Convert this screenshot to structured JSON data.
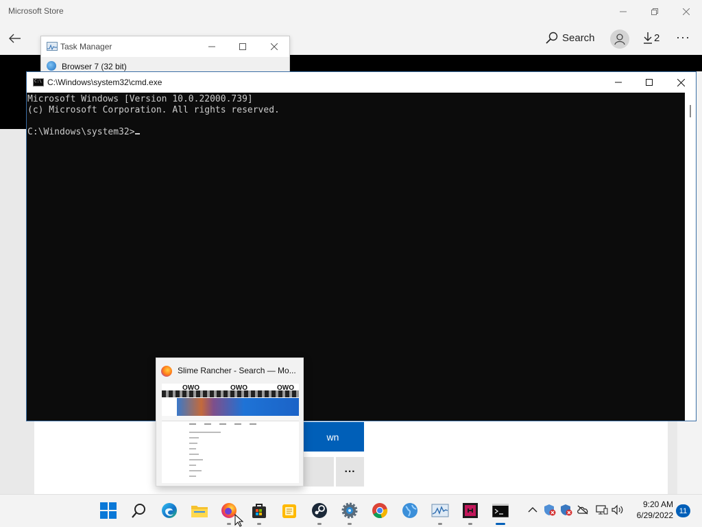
{
  "store": {
    "title": "Microsoft Store",
    "nav": {
      "search_label": "Search",
      "downloads_count": "2",
      "more_label": "···"
    },
    "install_label": "wn",
    "more_btn_label": "···"
  },
  "task_manager": {
    "title": "Task Manager",
    "process_name": "Browser 7 (32 bit)"
  },
  "cmd": {
    "title": "C:\\Windows\\system32\\cmd.exe",
    "lines": [
      "Microsoft Windows [Version 10.0.22000.739]",
      "(c) Microsoft Corporation. All rights reserved.",
      "",
      "C:\\Windows\\system32>"
    ]
  },
  "preview": {
    "title": "Slime Rancher - Search — Mo...",
    "thumb_labels": [
      "OWO",
      "OWO",
      "OWO"
    ]
  },
  "taskbar": {
    "apps": [
      {
        "name": "start",
        "icon": "windows-logo-icon"
      },
      {
        "name": "search",
        "icon": "search-icon"
      },
      {
        "name": "edge",
        "icon": "edge-icon"
      },
      {
        "name": "file-explorer",
        "icon": "folder-icon"
      },
      {
        "name": "firefox",
        "icon": "firefox-icon"
      },
      {
        "name": "microsoft-store",
        "icon": "store-icon"
      },
      {
        "name": "notes",
        "icon": "notepad-icon"
      },
      {
        "name": "steam",
        "icon": "steam-icon"
      },
      {
        "name": "settings",
        "icon": "gear-icon"
      },
      {
        "name": "chrome",
        "icon": "chrome-icon"
      },
      {
        "name": "browser",
        "icon": "globe-icon"
      },
      {
        "name": "task-manager",
        "icon": "task-manager-icon"
      },
      {
        "name": "app",
        "icon": "app-icon"
      },
      {
        "name": "command-prompt",
        "icon": "terminal-icon"
      }
    ],
    "clock_time": "9:20 AM",
    "clock_date": "6/29/2022",
    "notification_count": "11"
  }
}
